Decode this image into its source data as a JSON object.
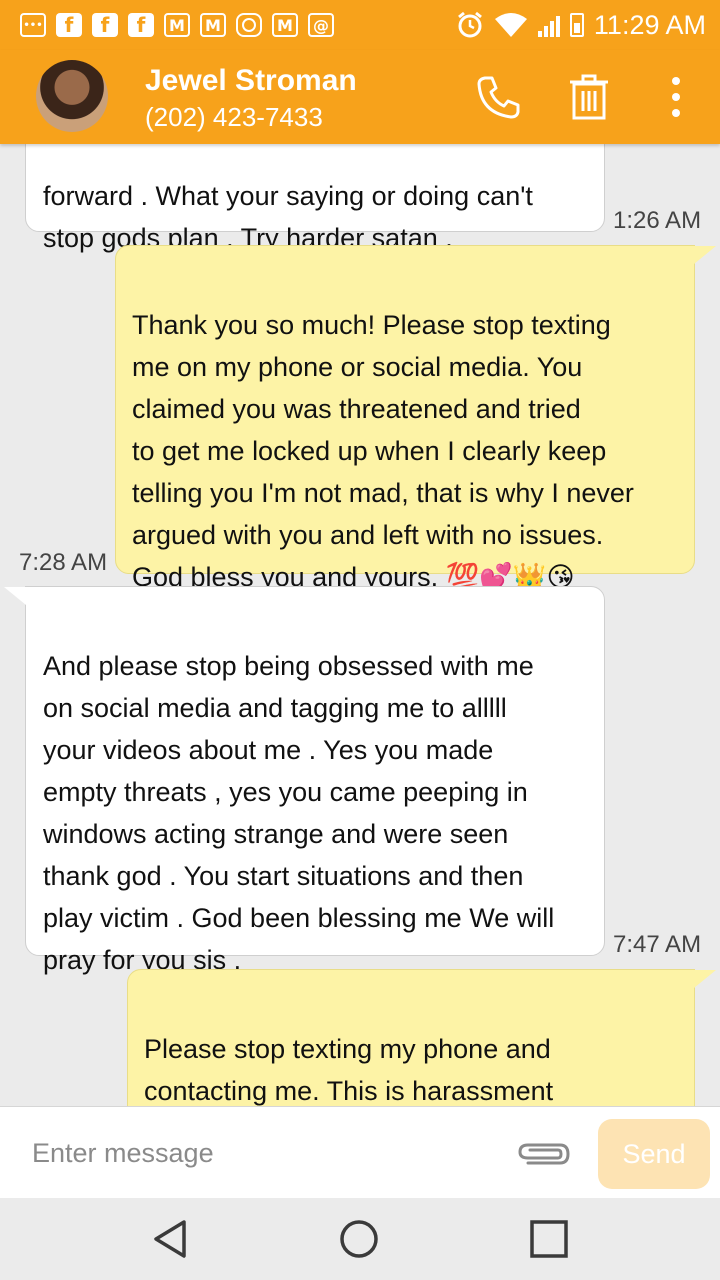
{
  "status_bar": {
    "time": "11:29 AM",
    "notification_icons": [
      "chat-icon",
      "facebook-icon",
      "facebook-icon",
      "facebook-icon",
      "gmail-icon",
      "gmail-icon",
      "instagram-icon",
      "gmail-icon",
      "email-icon"
    ],
    "fb_glyph": "f",
    "mail_glyph": "M",
    "at_glyph": "@",
    "dots_glyph": "•••"
  },
  "header": {
    "contact_name": "Jewel Stroman",
    "contact_phone": "(202) 423-7433",
    "accent_color": "#f7a21b"
  },
  "messages": [
    {
      "direction": "incoming",
      "text": "forward . What your saying or doing can't\nstop gods plan . Try harder satan .",
      "time": "1:26 AM"
    },
    {
      "direction": "outgoing",
      "text": "Thank you so much! Please stop texting\nme on my phone or social media. You\nclaimed you was threatened and tried\nto get me locked up when I clearly keep\ntelling you I'm not mad, that is why I never\nargued with you and left with no issues.\nGod bless you and yours. 💯💕👑😘",
      "time": "7:28 AM"
    },
    {
      "direction": "incoming",
      "text": "And please stop being obsessed with me\non social media and tagging me to alllll\nyour videos about me . Yes you made\nempty threats , yes you came peeping in\nwindows acting strange and were seen\nthank god . You start situations and then\nplay victim . God been blessing me We will\npray for you sis .",
      "time": "7:47 AM"
    },
    {
      "direction": "outgoing",
      "text": "Please stop texting my phone and\ncontacting me. This is harassment\nand your filing false charges while",
      "time": ""
    }
  ],
  "composer": {
    "placeholder": "Enter message",
    "send_label": "Send"
  }
}
